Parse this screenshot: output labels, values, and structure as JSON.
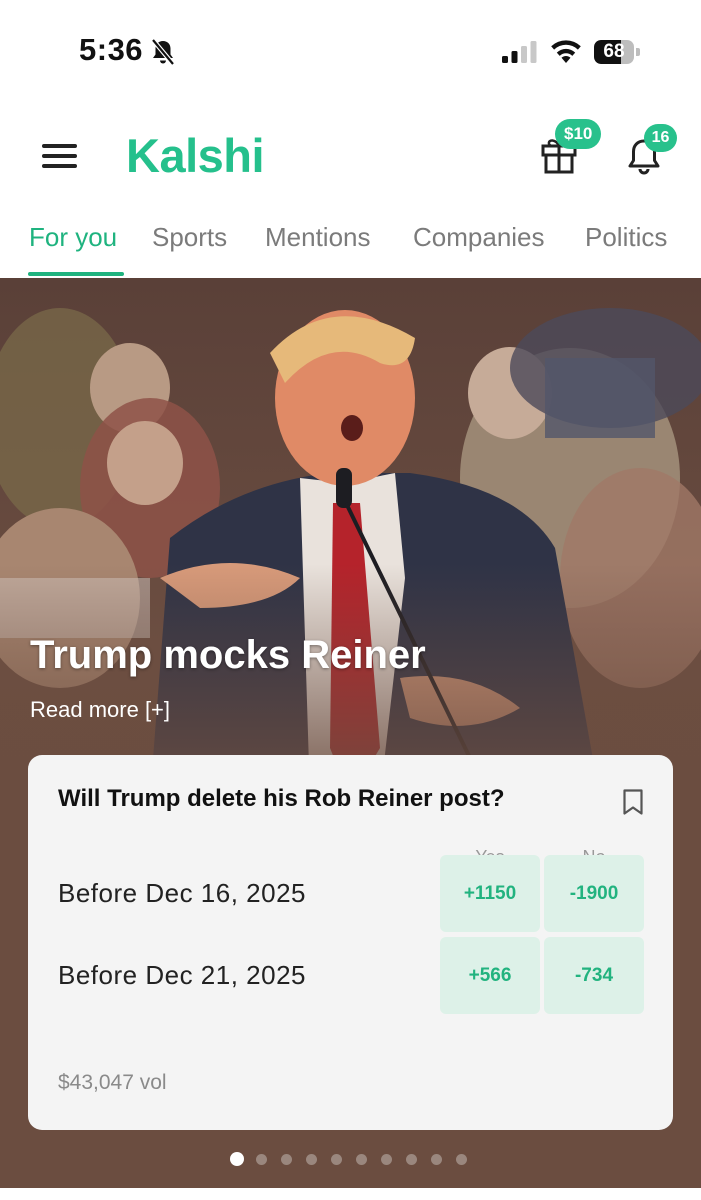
{
  "status_bar": {
    "time": "5:36",
    "battery": "68"
  },
  "header": {
    "logo": "Kalshi",
    "rewards_badge": "$10",
    "notification_count": "16"
  },
  "tabs": [
    {
      "label": "For you",
      "active": true
    },
    {
      "label": "Sports"
    },
    {
      "label": "Mentions"
    },
    {
      "label": "Companies"
    },
    {
      "label": "Politics"
    }
  ],
  "hero": {
    "title": "Trump mocks Reiner",
    "read_more": "Read more [+]"
  },
  "market": {
    "question": "Will Trump delete his Rob Reiner post?",
    "columns": {
      "yes": "Yes",
      "no": "No"
    },
    "rows": [
      {
        "label": "Before Dec 16, 2025",
        "yes": "+1150",
        "no": "-1900"
      },
      {
        "label": "Before Dec 21, 2025",
        "yes": "+566",
        "no": "-734"
      }
    ],
    "volume": "$43,047 vol"
  },
  "carousel": {
    "total_pages": 10,
    "current_page": 1
  },
  "colors": {
    "brand": "#25c08c",
    "hero_background": "#6b4d40",
    "price_chip": "#ddf1e8"
  }
}
